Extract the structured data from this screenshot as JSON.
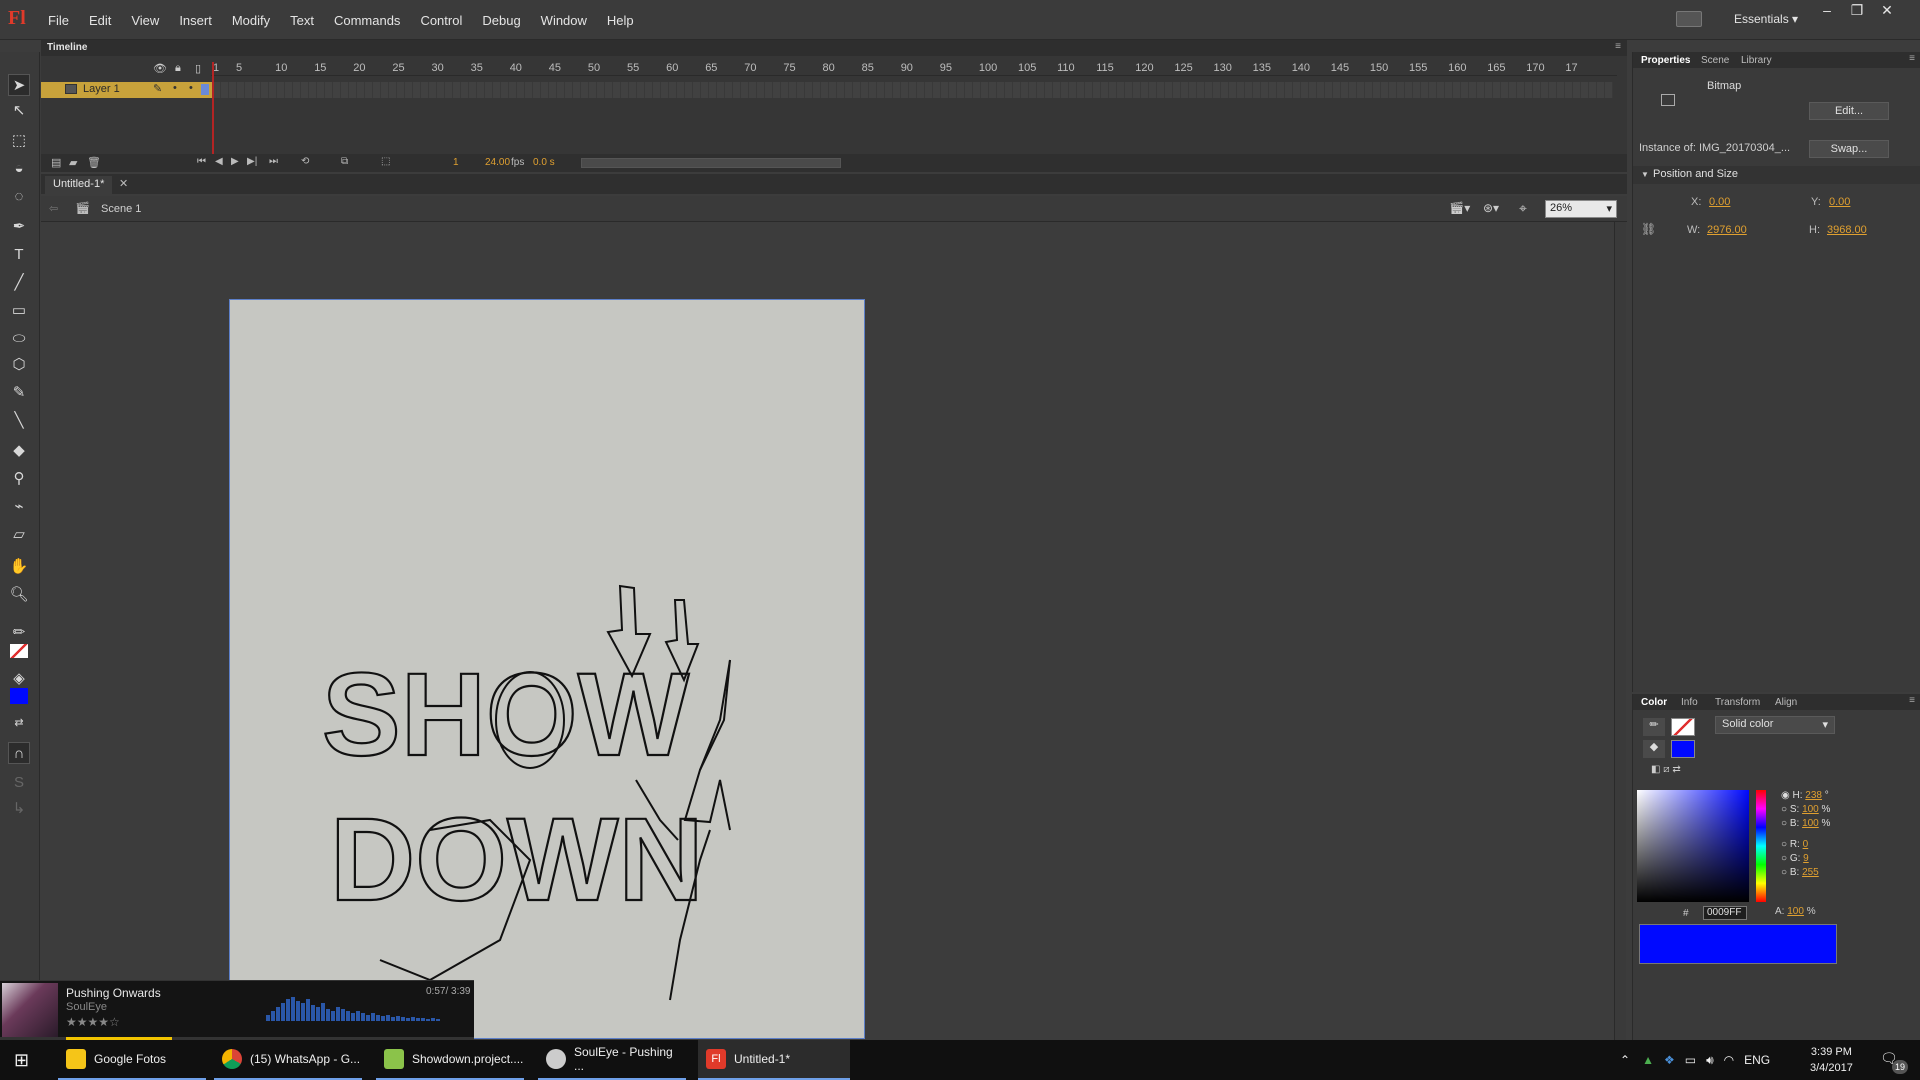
{
  "menubar": {
    "logo": "Fl",
    "items": [
      "File",
      "Edit",
      "View",
      "Insert",
      "Modify",
      "Text",
      "Commands",
      "Control",
      "Debug",
      "Window",
      "Help"
    ],
    "workspace": "Essentials"
  },
  "timeline": {
    "tab": "Timeline",
    "ruler": [
      "1",
      "5",
      "10",
      "15",
      "20",
      "25",
      "30",
      "35",
      "40",
      "45",
      "50",
      "55",
      "60",
      "65",
      "70",
      "75",
      "80",
      "85",
      "90",
      "95",
      "100",
      "105",
      "110",
      "115",
      "120",
      "125",
      "130",
      "135",
      "140",
      "145",
      "150",
      "155",
      "160",
      "165",
      "170",
      "17"
    ],
    "layer_name": "Layer 1",
    "current_frame": "1",
    "fps": "24.00",
    "fps_label": "fps",
    "time": "0.0 s"
  },
  "document": {
    "tab": "Untitled-1*",
    "scene": "Scene 1",
    "zoom": "26%"
  },
  "stage": {
    "drawing_text": [
      "SHOW",
      "DOWN"
    ]
  },
  "properties": {
    "tabs": [
      "Properties",
      "Scene",
      "Library"
    ],
    "type": "Bitmap",
    "edit_button": "Edit...",
    "instance_label": "Instance of:",
    "instance_name": "IMG_20170304_...",
    "swap_button": "Swap...",
    "section": "Position and Size",
    "x_label": "X:",
    "x": "0.00",
    "y_label": "Y:",
    "y": "0.00",
    "w_label": "W:",
    "w": "2976.00",
    "h_label": "H:",
    "h": "3968.00"
  },
  "color_panel": {
    "tabs": [
      "Color",
      "Info",
      "Transform",
      "Align"
    ],
    "fill_type": "Solid color",
    "hsb": {
      "H": "238",
      "S": "100",
      "B": "100"
    },
    "rgb": {
      "R": "0",
      "G": "9",
      "B": "255"
    },
    "hex_label": "#",
    "hex": "0009FF",
    "alpha_label": "A:",
    "alpha": "100",
    "units": {
      "deg": "°",
      "pct": "%"
    },
    "fill_color": "#0009ff"
  },
  "music": {
    "track": "Pushing Onwards",
    "artist": "SoulEye",
    "time": "0:57/ 3:39",
    "rating": 4
  },
  "taskbar": {
    "items": [
      {
        "label": "Google Fotos",
        "color": "#f5c518"
      },
      {
        "label": "(15) WhatsApp - G...",
        "color": "#2f9e44"
      },
      {
        "label": "Showdown.project....",
        "color": "#8bc34a"
      },
      {
        "label": "SoulEye - Pushing ...",
        "color": "#cccccc"
      },
      {
        "label": "Untitled-1*",
        "color": "#e03a2a"
      }
    ],
    "lang": "ENG",
    "time": "3:39 PM",
    "date": "3/4/2017",
    "notif_count": "19"
  },
  "colors": {
    "accent_orange": "#e0a030",
    "layer_highlight": "#c8a23b",
    "playhead": "#b32424",
    "stage_border": "#5c7fc9"
  }
}
